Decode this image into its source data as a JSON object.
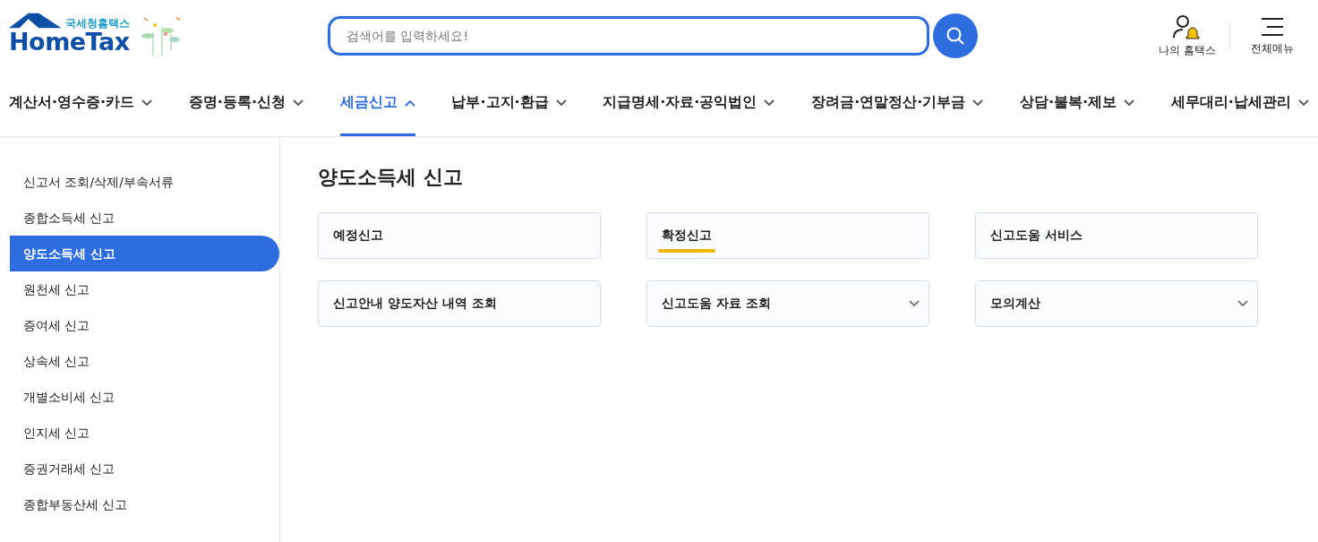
{
  "logo": {
    "subtitle": "국세청홈택스",
    "title": "HomeTax"
  },
  "search": {
    "placeholder": "검색어를 입력하세요!"
  },
  "header_links": [
    {
      "label": "나의 홈택스",
      "kind": "user"
    },
    {
      "label": "전체메뉴",
      "kind": "menu"
    }
  ],
  "nav": [
    {
      "label": "계산서·영수증·카드",
      "selected": false
    },
    {
      "label": "증명·등록·신청",
      "selected": false
    },
    {
      "label": "세금신고",
      "selected": true
    },
    {
      "label": "납부·고지·환급",
      "selected": false
    },
    {
      "label": "지급명세·자료·공익법인",
      "selected": false
    },
    {
      "label": "장려금·연말정산·기부금",
      "selected": false
    },
    {
      "label": "상담·불복·제보",
      "selected": false
    },
    {
      "label": "세무대리·납세관리",
      "selected": false
    }
  ],
  "sidebar": {
    "items": [
      {
        "label": "신고서 조회/삭제/부속서류",
        "selected": false
      },
      {
        "label": "종합소득세 신고",
        "selected": false
      },
      {
        "label": "양도소득세 신고",
        "selected": true
      },
      {
        "label": "원천세 신고",
        "selected": false
      },
      {
        "label": "증여세 신고",
        "selected": false
      },
      {
        "label": "상속세 신고",
        "selected": false
      },
      {
        "label": "개별소비세 신고",
        "selected": false
      },
      {
        "label": "인지세 신고",
        "selected": false
      },
      {
        "label": "증권거래세 신고",
        "selected": false
      },
      {
        "label": "종합부동산세 신고",
        "selected": false
      }
    ]
  },
  "content": {
    "title": "양도소득세 신고",
    "cards": [
      {
        "label": "예정신고",
        "highlighted": false,
        "expandable": false
      },
      {
        "label": "확정신고",
        "highlighted": true,
        "expandable": false
      },
      {
        "label": "신고도움 서비스",
        "highlighted": false,
        "expandable": false
      },
      {
        "label": "신고안내 양도자산 내역 조회",
        "highlighted": false,
        "expandable": false
      },
      {
        "label": "신고도움 자료 조회",
        "highlighted": false,
        "expandable": true
      },
      {
        "label": "모의계산",
        "highlighted": false,
        "expandable": true
      }
    ]
  }
}
